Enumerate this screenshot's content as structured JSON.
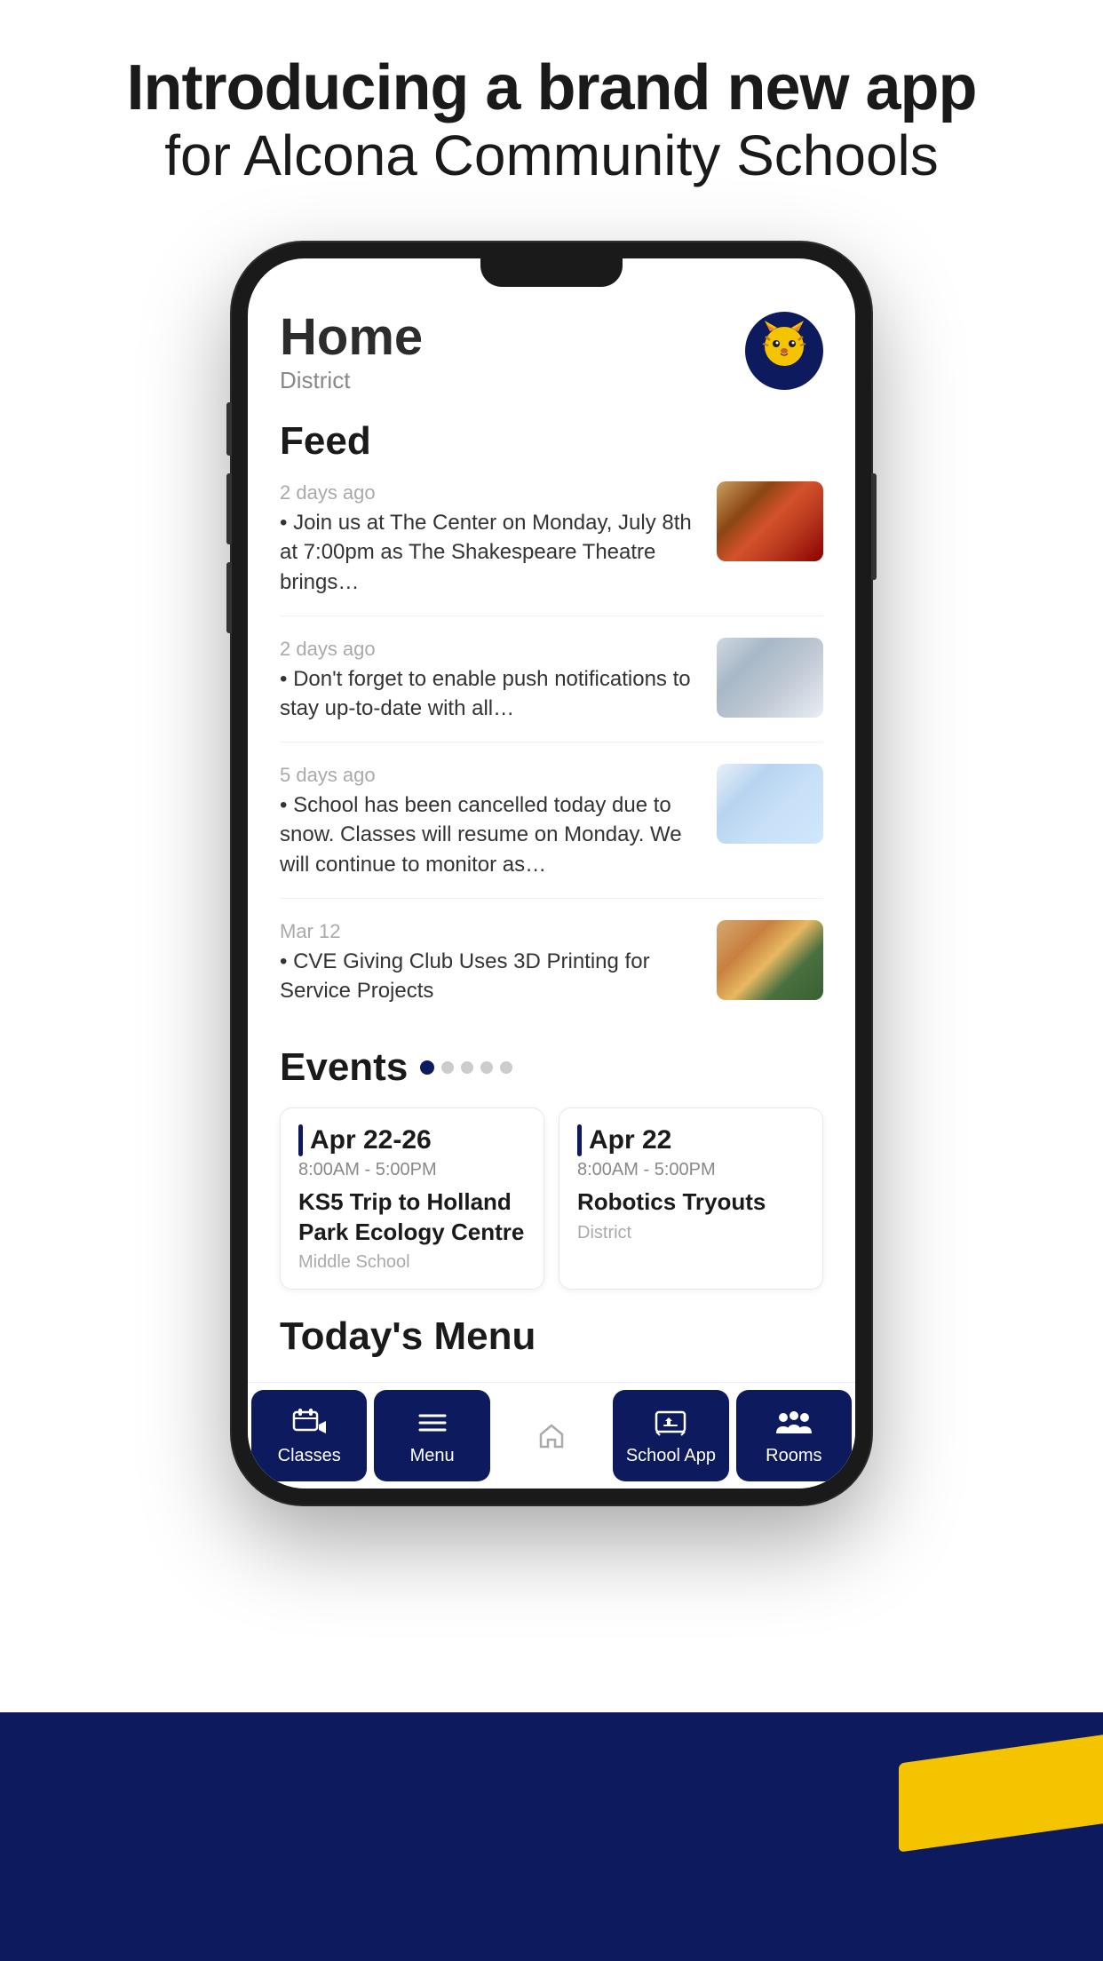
{
  "page": {
    "background_color": "#ffffff",
    "navy_color": "#0d1b5e",
    "yellow_color": "#f5c400"
  },
  "header": {
    "headline_bold": "Introducing a brand new app",
    "headline_regular": "for Alcona Community Schools"
  },
  "phone": {
    "screen": {
      "home_title": "Home",
      "home_subtitle": "District",
      "feed_section_label": "Feed",
      "feed_items": [
        {
          "timestamp": "2 days ago",
          "body": "• Join us at The Center on Monday, July 8th at 7:00pm as The Shakespeare Theatre brings…",
          "thumb_type": "auditorium"
        },
        {
          "timestamp": "2 days ago",
          "body": "• Don't forget to enable push notifications to stay up-to-date with all…",
          "thumb_type": "phone"
        },
        {
          "timestamp": "5 days ago",
          "body": "• School has been cancelled today due to snow. Classes will resume on Monday. We will continue to monitor as…",
          "thumb_type": "snow"
        },
        {
          "timestamp": "Mar 12",
          "body": "• CVE Giving Club Uses 3D Printing for Service Projects",
          "thumb_type": "classroom"
        }
      ],
      "events_section_label": "Events",
      "events_dots": [
        {
          "active": true
        },
        {
          "active": false
        },
        {
          "active": false
        },
        {
          "active": false
        },
        {
          "active": false
        }
      ],
      "events": [
        {
          "date": "Apr 22-26",
          "time": "8:00AM  -  5:00PM",
          "name": "KS5 Trip to Holland Park Ecology Centre",
          "location": "Middle School"
        },
        {
          "date": "Apr 22",
          "time": "8:00AM  -  5:00PM",
          "name": "Robotics Tryouts",
          "location": "District"
        }
      ],
      "todays_menu_label": "Today's Menu",
      "nav_items": [
        {
          "label": "Classes",
          "icon": "classes",
          "active": true
        },
        {
          "label": "Menu",
          "icon": "menu",
          "active": true
        },
        {
          "label": "",
          "icon": "home",
          "active": false
        },
        {
          "label": "School App",
          "icon": "school-app",
          "active": true
        },
        {
          "label": "Rooms",
          "icon": "rooms",
          "active": true
        }
      ]
    }
  }
}
